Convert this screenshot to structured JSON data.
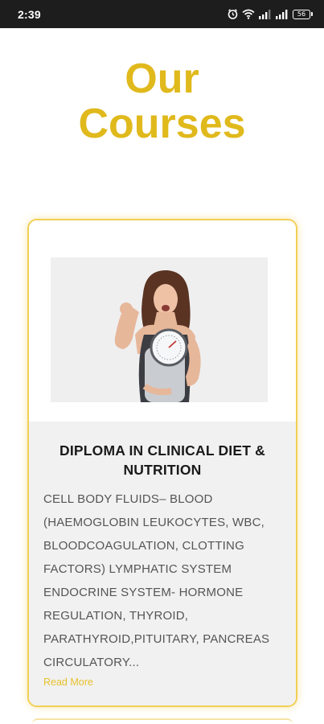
{
  "status_bar": {
    "time": "2:39",
    "battery": "56",
    "icons": [
      "alarm-icon",
      "wifi-icon",
      "signal-icon",
      "signal-icon",
      "battery-icon"
    ]
  },
  "page": {
    "title_line1": "Our",
    "title_line2": "Courses",
    "accent_color": "#e0b91c"
  },
  "course": {
    "title": "DIPLOMA IN CLINICAL DIET & NUTRITION",
    "description": "CELL BODY FLUIDS– BLOOD (HAEMOGLOBIN LEUKOCYTES, WBC, BLOODCOAGULATION, CLOTTING FACTORS) LYMPHATIC SYSTEM ENDOCRINE SYSTEM- HORMONE REGULATION, THYROID, PARATHYROID,PITUITARY, PANCREAS CIRCULATORY...",
    "read_more": "Read More"
  }
}
